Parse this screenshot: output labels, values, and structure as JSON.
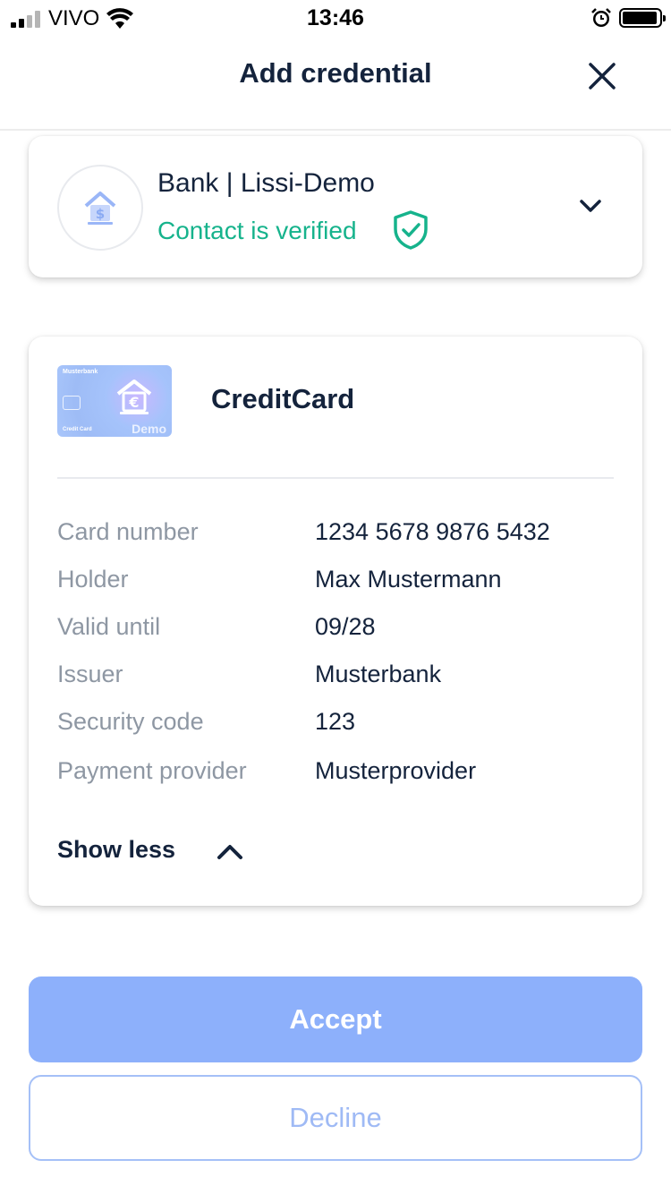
{
  "status_bar": {
    "carrier": "VIVO",
    "time": "13:46",
    "icons": [
      "signal-icon",
      "wifi-icon",
      "alarm-icon",
      "battery-icon"
    ]
  },
  "header": {
    "title": "Add credential",
    "close_icon": "close-icon"
  },
  "contact": {
    "name": "Bank | Lissi-Demo",
    "status": "Contact is verified",
    "status_color": "#16b38c",
    "icons": [
      "bank-logo-icon",
      "shield-check-icon",
      "chevron-down-icon"
    ]
  },
  "credential": {
    "title": "CreditCard",
    "thumbnail": {
      "bank": "Musterbank",
      "type": "Credit Card",
      "badge": "Demo"
    },
    "attributes": [
      {
        "label": "Card number",
        "value": "1234 5678 9876 5432"
      },
      {
        "label": "Holder",
        "value": "Max Mustermann"
      },
      {
        "label": "Valid until",
        "value": "09/28"
      },
      {
        "label": "Issuer",
        "value": "Musterbank"
      },
      {
        "label": "Security code",
        "value": "123"
      },
      {
        "label": "Payment provider",
        "value": "Musterprovider"
      }
    ],
    "toggle_label": "Show less"
  },
  "actions": {
    "accept_label": "Accept",
    "decline_label": "Decline",
    "accent_color": "#8db0fb"
  }
}
